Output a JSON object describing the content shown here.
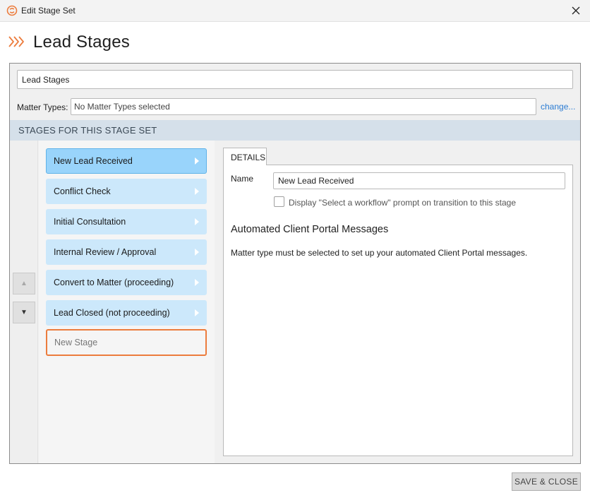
{
  "window": {
    "title": "Edit Stage Set",
    "app_icon": "app-logo-icon",
    "close_icon": "close-icon"
  },
  "header": {
    "icon": "stages-chevron-icon",
    "title": "Lead Stages",
    "accent_color": "#ec7c3d"
  },
  "form": {
    "name_value": "Lead Stages",
    "matter_types_label": "Matter Types:",
    "matter_types_value": "No Matter Types selected",
    "change_link": "change..."
  },
  "section": {
    "title": "STAGES FOR THIS STAGE SET"
  },
  "stages": [
    {
      "label": "New Lead Received",
      "selected": true
    },
    {
      "label": "Conflict Check",
      "selected": false
    },
    {
      "label": "Initial Consultation",
      "selected": false
    },
    {
      "label": "Internal Review / Approval",
      "selected": false
    },
    {
      "label": "Convert to Matter (proceeding)",
      "selected": false
    },
    {
      "label": "Lead Closed (not proceeding)",
      "selected": false
    }
  ],
  "new_stage_placeholder": "New Stage",
  "move_controls": {
    "up_icon": "arrow-up-icon",
    "down_icon": "arrow-down-icon"
  },
  "details": {
    "tab_label": "DETAILS",
    "name_label": "Name",
    "name_value": "New Lead Received",
    "checkbox_label": "Display \"Select a workflow\" prompt on transition to this stage",
    "checkbox_checked": false,
    "acp_heading": "Automated Client Portal Messages",
    "acp_text": "Matter type must be selected to set up your automated Client Portal messages."
  },
  "footer": {
    "save_close_label": "SAVE & CLOSE"
  }
}
